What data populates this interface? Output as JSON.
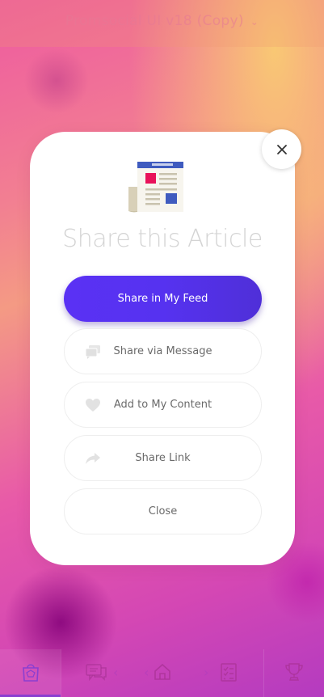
{
  "header": {
    "app_title": "Promsocial UI v18 (Copy)",
    "title_chevron": "⌄"
  },
  "modal": {
    "title": "Share this Article",
    "icon": "newspaper-icon",
    "close_icon": "close-icon",
    "actions": [
      {
        "label": "Share in My Feed",
        "icon": null,
        "style": "primary"
      },
      {
        "label": "Share via Message",
        "icon": "chat-bubbles-icon",
        "style": "secondary"
      },
      {
        "label": "Add to My Content",
        "icon": "heart-icon",
        "style": "secondary"
      },
      {
        "label": "Share Link",
        "icon": "share-arrow-icon",
        "style": "secondary"
      },
      {
        "label": "Close",
        "icon": null,
        "style": "secondary"
      }
    ]
  },
  "bottom_nav": {
    "items": [
      {
        "icon": "shopping-bag-icon",
        "active": true
      },
      {
        "icon": "chat-icon",
        "active": false
      },
      {
        "icon": "home-icon",
        "active": false
      },
      {
        "icon": "checklist-icon",
        "active": false
      },
      {
        "icon": "trophy-icon",
        "active": false
      }
    ],
    "prev_arrow": "‹",
    "next_arrow": "›"
  },
  "colors": {
    "primary_button": "#5a31f4",
    "accent_purple": "#8a3fd0",
    "background_pink": "#ee5aa0",
    "background_orange": "#f9c874",
    "title_gray": "#d4d4d4",
    "icon_gray": "#e2e2e2"
  }
}
